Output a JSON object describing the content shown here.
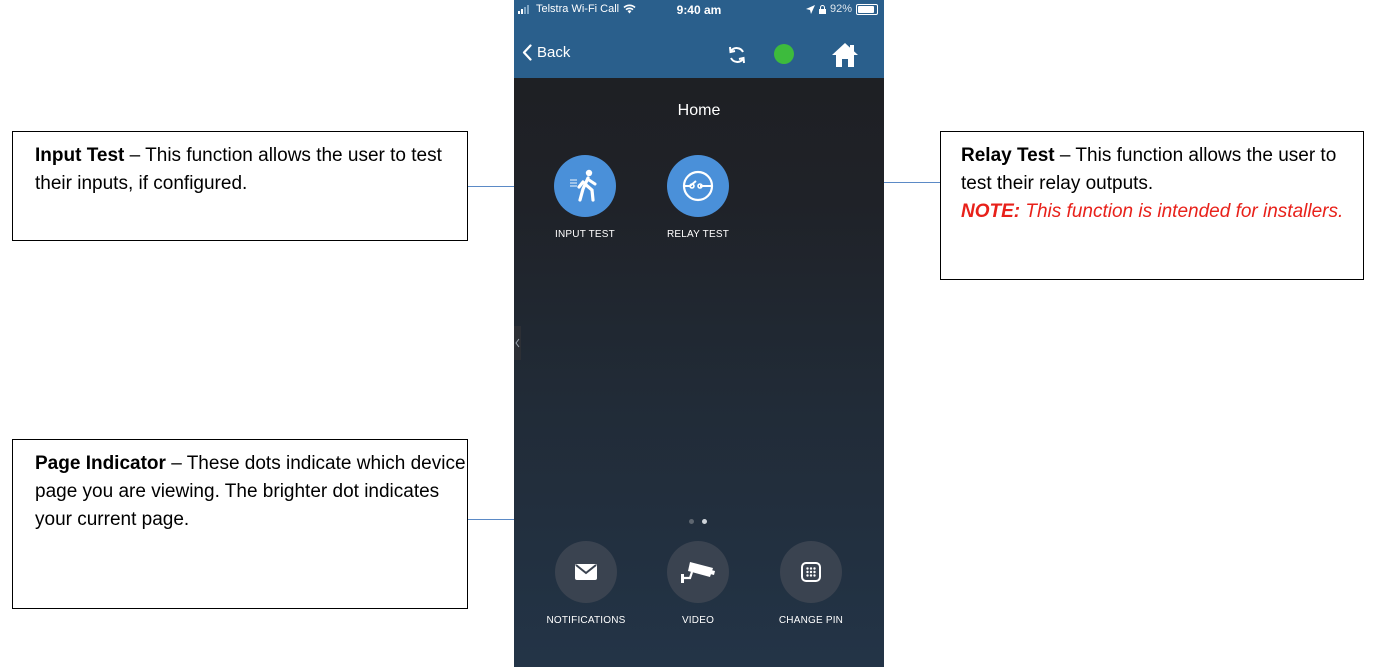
{
  "callouts": {
    "input_test": {
      "title": "Input Test",
      "text": " – This function allows the user to test their inputs, if configured."
    },
    "relay_test": {
      "title": "Relay Test",
      "text": " – This function allows the user to test their relay outputs.",
      "note_label": "NOTE:",
      "note_text": " This function is intended for installers."
    },
    "page_indicator": {
      "title": "Page Indicator",
      "text": " – These dots indicate which device page you are viewing. The brighter dot indicates your current page."
    }
  },
  "status_bar": {
    "carrier": "Telstra Wi-Fi Call",
    "time": "9:40 am",
    "battery": "92%"
  },
  "nav": {
    "back_label": "Back",
    "connection_color": "#3dbb3d"
  },
  "page_title": "Home",
  "tiles": [
    {
      "label": "INPUT TEST",
      "icon": "walking-person-icon"
    },
    {
      "label": "RELAY TEST",
      "icon": "relay-icon"
    }
  ],
  "bottom_tiles": [
    {
      "label": "NOTIFICATIONS",
      "icon": "envelope-icon"
    },
    {
      "label": "VIDEO",
      "icon": "security-camera-icon"
    },
    {
      "label": "CHANGE PIN",
      "icon": "keypad-icon"
    }
  ],
  "page_indicator": {
    "total": 2,
    "current": 2
  },
  "colors": {
    "header": "#2a5f8c",
    "tile_active": "#4a90d9",
    "tile_inactive": "#3a4350",
    "note": "#e8211a",
    "leader_line": "#5b8ac6"
  }
}
